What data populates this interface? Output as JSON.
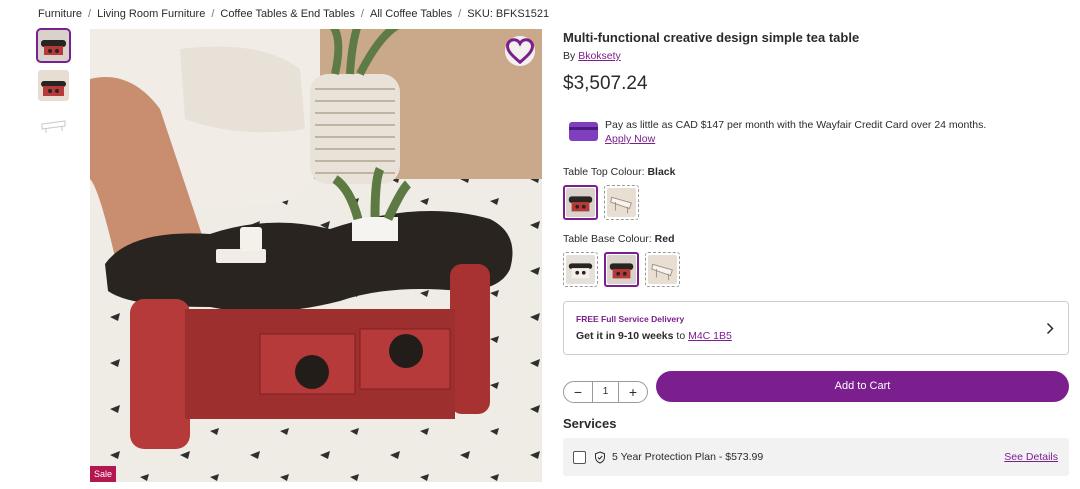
{
  "breadcrumb": {
    "items": [
      "Furniture",
      "Living Room Furniture",
      "Coffee Tables & End Tables",
      "All Coffee Tables"
    ],
    "sku": "SKU: BFKS1521",
    "separator": "/"
  },
  "gallery": {
    "sale_badge": "Sale",
    "favorite_icon": "heart-outline-icon"
  },
  "product": {
    "title": "Multi-functional creative design simple tea table",
    "by_prefix": "By",
    "brand": "Bkoksety",
    "price": "$3,507.24"
  },
  "credit": {
    "text": "Pay as little as CAD $147 per month with the Wayfair Credit Card over 24 months.",
    "apply_label": "Apply Now"
  },
  "options": {
    "top": {
      "label": "Table Top Colour:",
      "selected": "Black",
      "selected_index": 0
    },
    "base": {
      "label": "Table Base Colour:",
      "selected": "Red",
      "selected_index": 1
    }
  },
  "delivery": {
    "headline": "FREE Full Service Delivery",
    "eta_prefix": "Get it in",
    "eta_range": "9-10 weeks",
    "eta_to": "to",
    "postal_code": "M4C 1B5"
  },
  "cart": {
    "quantity": "1",
    "minus": "−",
    "plus": "+",
    "add_label": "Add to Cart"
  },
  "services": {
    "heading": "Services",
    "plan_label": "5 Year Protection Plan - $573.99",
    "details_label": "See Details"
  },
  "colors": {
    "accent": "#7b1f8e",
    "sale": "#b4164f",
    "table_top": "#2a2420",
    "table_base": "#b73a3a"
  }
}
